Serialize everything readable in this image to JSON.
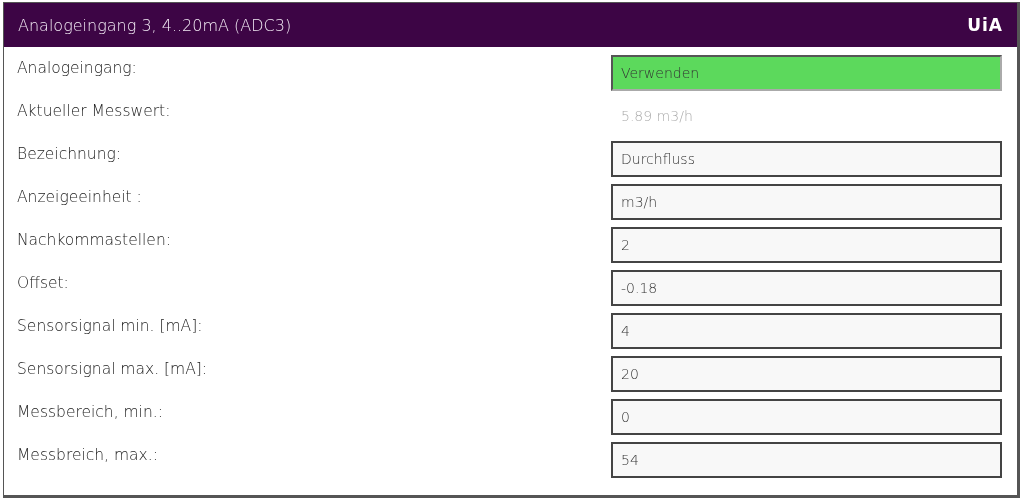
{
  "header": {
    "title": "Analogeingang 3, 4..20mA (ADC3)",
    "logo": "UiA"
  },
  "rows": [
    {
      "label": "Analogeingang:",
      "kind": "select",
      "value": "Verwenden"
    },
    {
      "label": "Aktueller Messwert:",
      "kind": "readout",
      "value": "5.89 m3/h"
    },
    {
      "label": "Bezeichnung:",
      "kind": "input",
      "value": "Durchfluss"
    },
    {
      "label": "Anzeigeeinheit :",
      "kind": "input",
      "value": "m3/h"
    },
    {
      "label": "Nachkommastellen:",
      "kind": "input",
      "value": "2"
    },
    {
      "label": "Offset:",
      "kind": "input",
      "value": "-0.18"
    },
    {
      "label": "Sensorsignal min. [mA]:",
      "kind": "input",
      "value": "4"
    },
    {
      "label": "Sensorsignal max. [mA]:",
      "kind": "input",
      "value": "20"
    },
    {
      "label": "Messbereich, min.:",
      "kind": "input",
      "value": "0"
    },
    {
      "label": "Messbreich, max.:",
      "kind": "input",
      "value": "54"
    }
  ]
}
